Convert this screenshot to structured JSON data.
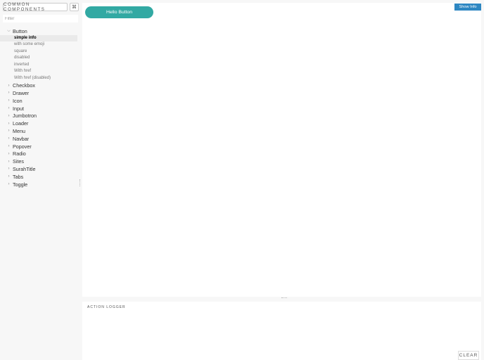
{
  "sidebar": {
    "brand_label": "COMMON COMPONENTS",
    "shortcut_icon": "⌘",
    "filter_placeholder": "Filter",
    "kinds": [
      {
        "label": "Button",
        "expanded": true,
        "stories": [
          "simple info",
          "with some emoji",
          "square",
          "disabled",
          "inverted",
          "With href",
          "With href (disabled)"
        ],
        "selected_story": 0
      },
      {
        "label": "Checkbox",
        "expanded": false
      },
      {
        "label": "Drawer",
        "expanded": false
      },
      {
        "label": "Icon",
        "expanded": false
      },
      {
        "label": "Input",
        "expanded": false
      },
      {
        "label": "Jumbotron",
        "expanded": false
      },
      {
        "label": "Loader",
        "expanded": false
      },
      {
        "label": "Menu",
        "expanded": false
      },
      {
        "label": "Navbar",
        "expanded": false
      },
      {
        "label": "Popover",
        "expanded": false
      },
      {
        "label": "Radio",
        "expanded": false
      },
      {
        "label": "Sites",
        "expanded": false
      },
      {
        "label": "SurahTitle",
        "expanded": false
      },
      {
        "label": "Tabs",
        "expanded": false
      },
      {
        "label": "Toggle",
        "expanded": false
      }
    ]
  },
  "preview": {
    "hello_button_label": "Hello Button",
    "show_info_label": "Show Info"
  },
  "logger": {
    "title": "ACTION LOGGER",
    "clear_label": "CLEAR"
  },
  "colors": {
    "accent_teal": "#32a9a3",
    "show_info_blue": "#2e87c2"
  }
}
